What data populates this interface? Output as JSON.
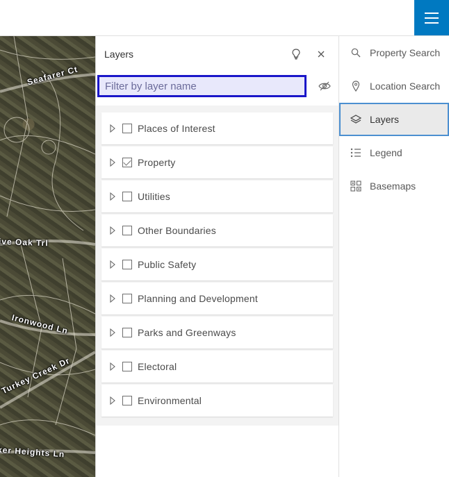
{
  "topbar": {
    "menu_icon": "hamburger-menu-icon",
    "accent": "#0079c1"
  },
  "map": {
    "labels": [
      "Seafarer Ct",
      "ive Oak Trl",
      "Ironwood Ln",
      "Turkey Creek Dr",
      "ker Heights Ln"
    ]
  },
  "panel": {
    "title": "Layers",
    "tip_icon": "lightbulb-icon",
    "close_icon": "close-icon",
    "filter_placeholder": "Filter by layer name",
    "visibility_icon": "eye-off-icon",
    "layers": [
      {
        "label": "Places of Interest",
        "checked": false
      },
      {
        "label": "Property",
        "checked": true
      },
      {
        "label": "Utilities",
        "checked": false
      },
      {
        "label": "Other Boundaries",
        "checked": false
      },
      {
        "label": "Public Safety",
        "checked": false
      },
      {
        "label": "Planning and Development",
        "checked": false
      },
      {
        "label": "Parks and Greenways",
        "checked": false
      },
      {
        "label": "Electoral",
        "checked": false
      },
      {
        "label": "Environmental",
        "checked": false
      }
    ]
  },
  "sidenav": {
    "items": [
      {
        "label": "Property Search",
        "icon": "search-icon",
        "active": false
      },
      {
        "label": "Location Search",
        "icon": "map-pin-icon",
        "active": false
      },
      {
        "label": "Layers",
        "icon": "layers-icon",
        "active": true
      },
      {
        "label": "Legend",
        "icon": "legend-list-icon",
        "active": false
      },
      {
        "label": "Basemaps",
        "icon": "basemap-grid-icon",
        "active": false
      }
    ],
    "active_border": "#4b8fd0"
  }
}
